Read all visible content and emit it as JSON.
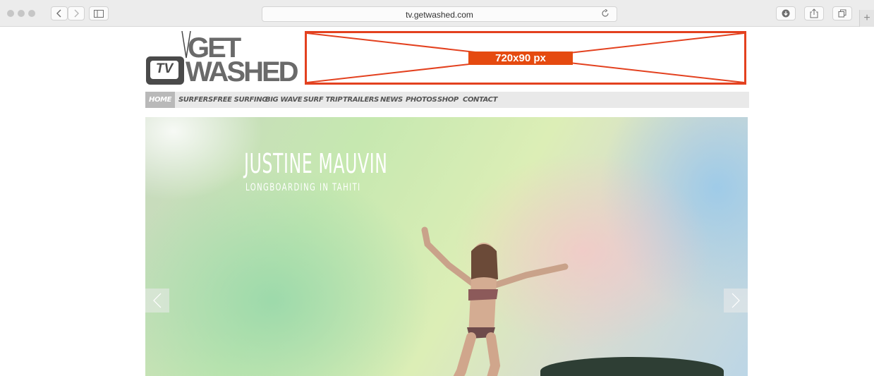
{
  "browser": {
    "url": "tv.getwashed.com",
    "new_tab_label": "+"
  },
  "logo": {
    "tv_text": "TV",
    "line1": "GET",
    "line2": "WASHED"
  },
  "ad_banner": {
    "label": "720x90 px",
    "border_color": "#e3411f",
    "label_bg": "#e54a10"
  },
  "nav": {
    "items": [
      "HOME",
      "SURFERS",
      "FREE SURFING",
      "BIG WAVE",
      "SURF TRIP",
      "TRAILERS",
      "NEWS",
      "PHOTOS",
      "SHOP",
      "CONTACT"
    ],
    "active_index": 0
  },
  "hero": {
    "title": "JUSTINE MAUVIN",
    "subtitle": "LONGBOARDING IN TAHITI"
  },
  "icons": {
    "back": "chevron-left-icon",
    "forward": "chevron-right-icon",
    "sidebar": "sidebar-icon",
    "reload": "reload-icon",
    "download": "download-icon",
    "share": "share-icon",
    "tabs": "tabs-icon",
    "slider_prev": "chevron-left-icon",
    "slider_next": "chevron-right-icon"
  }
}
